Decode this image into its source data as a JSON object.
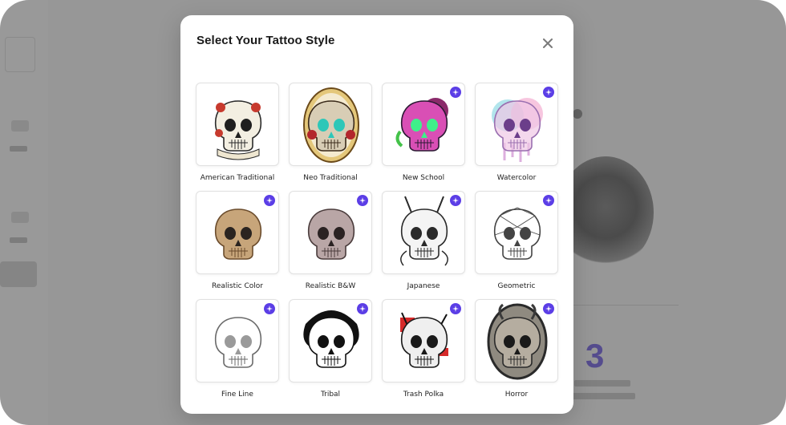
{
  "modal": {
    "title": "Select Your Tattoo Style",
    "close_icon": "close-icon"
  },
  "background": {
    "step_number": "3"
  },
  "styles": [
    {
      "label": "American Traditional",
      "premium": false,
      "icon": "american-traditional-skull"
    },
    {
      "label": "Neo Traditional",
      "premium": false,
      "icon": "neo-traditional-skull"
    },
    {
      "label": "New School",
      "premium": true,
      "icon": "new-school-skull"
    },
    {
      "label": "Watercolor",
      "premium": true,
      "icon": "watercolor-skull"
    },
    {
      "label": "Realistic Color",
      "premium": true,
      "icon": "realistic-color-skull"
    },
    {
      "label": "Realistic B&W",
      "premium": true,
      "icon": "realistic-bw-skull"
    },
    {
      "label": "Japanese",
      "premium": true,
      "icon": "japanese-oni-skull"
    },
    {
      "label": "Geometric",
      "premium": true,
      "icon": "geometric-skull"
    },
    {
      "label": "Fine Line",
      "premium": true,
      "icon": "fine-line-skull"
    },
    {
      "label": "Tribal",
      "premium": true,
      "icon": "tribal-skull"
    },
    {
      "label": "Trash Polka",
      "premium": true,
      "icon": "trash-polka-skull"
    },
    {
      "label": "Horror",
      "premium": true,
      "icon": "horror-skull"
    }
  ],
  "colors": {
    "accent": "#5b3ee6",
    "overlay": "rgba(60,60,60,0.5)"
  }
}
